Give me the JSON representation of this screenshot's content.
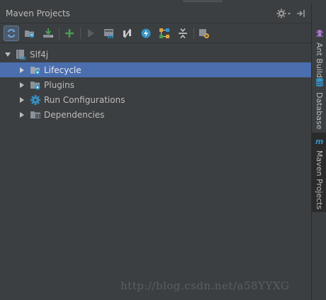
{
  "panel": {
    "title": "Maven Projects"
  },
  "toolbar": {
    "buttons": [
      {
        "icon": "reimport-icon",
        "active": true
      },
      {
        "icon": "generate-sources-icon"
      },
      {
        "icon": "download-icon"
      },
      {
        "icon": "add-icon"
      },
      {
        "icon": "run-icon"
      },
      {
        "icon": "execute-goal-icon"
      },
      {
        "icon": "skip-tests-icon"
      },
      {
        "icon": "offline-icon"
      },
      {
        "icon": "show-dependencies-icon"
      },
      {
        "icon": "collapse-all-icon"
      },
      {
        "icon": "settings-icon"
      }
    ]
  },
  "tree": {
    "root": {
      "label": "Slf4j",
      "expanded": true
    },
    "children": [
      {
        "label": "Lifecycle",
        "selected": true
      },
      {
        "label": "Plugins"
      },
      {
        "label": "Run Configurations"
      },
      {
        "label": "Dependencies"
      }
    ]
  },
  "side_tabs": [
    {
      "label": "Ant Build"
    },
    {
      "label": "Database"
    },
    {
      "label": "Maven Projects",
      "active": true
    }
  ],
  "watermark": "http://blog.csdn.net/a58YYXG",
  "colors": {
    "panel_bg": "#3c3f41",
    "selection": "#4b6eaf",
    "text": "#bbbbbb",
    "accent_blue": "#3592c4",
    "accent_green": "#499c54"
  }
}
